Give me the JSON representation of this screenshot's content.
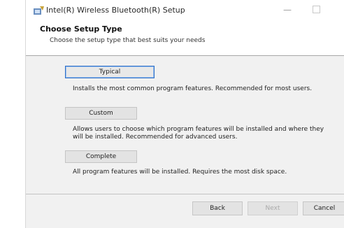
{
  "window": {
    "title": "Intel(R) Wireless Bluetooth(R) Setup",
    "minimize_glyph": "—"
  },
  "header": {
    "title": "Choose Setup Type",
    "subtitle": "Choose the setup type that best suits your needs"
  },
  "options": [
    {
      "label": "Typical",
      "description": "Installs the most common program features. Recommended for most users.",
      "focused": true
    },
    {
      "label": "Custom",
      "description": "Allows users to choose which program features will be installed and where they will be installed. Recommended for advanced users.",
      "focused": false
    },
    {
      "label": "Complete",
      "description": "All program features will be installed. Requires the most disk space.",
      "focused": false
    }
  ],
  "footer": {
    "back_label": "Back",
    "next_label": "Next",
    "cancel_label": "Cancel"
  },
  "colors": {
    "focus_border": "#2f6fc7",
    "panel_bg": "#f1f1f1",
    "header_bg": "#ffffff"
  },
  "icons": {
    "app": "installer-app-icon",
    "minimize": "minimize-icon",
    "maximize": "maximize-icon"
  }
}
